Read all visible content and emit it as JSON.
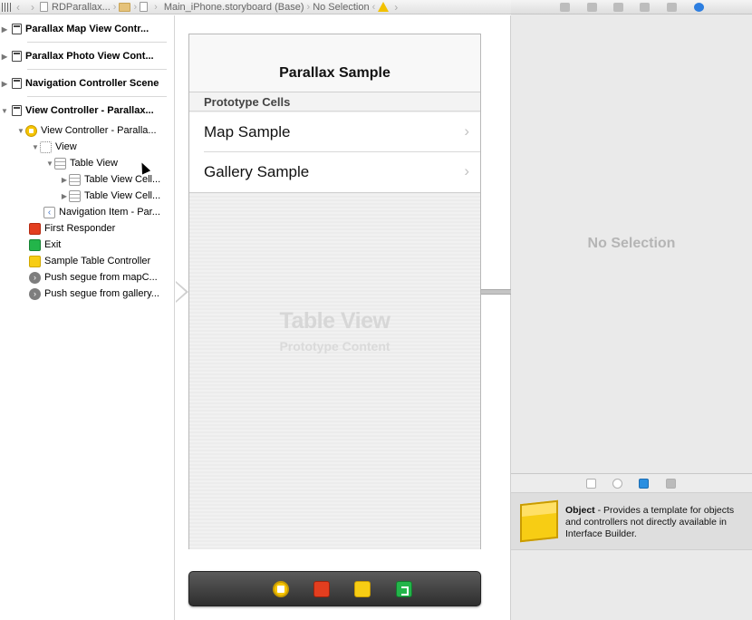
{
  "jumpbar": {
    "project": "RDParallax...",
    "file": "Main_iPhone.storyboard (Base)",
    "selection": "No Selection"
  },
  "outline": {
    "scenes": [
      {
        "label": "Parallax Map View Contr..."
      },
      {
        "label": "Parallax Photo View Cont..."
      },
      {
        "label": "Navigation Controller Scene"
      },
      {
        "label": "View Controller - Parallax..."
      }
    ],
    "tree": [
      {
        "label": "View Controller - Paralla...",
        "icon": "view-controller-icon"
      },
      {
        "label": "View",
        "icon": "view-icon"
      },
      {
        "label": "Table View",
        "icon": "table-view-icon"
      },
      {
        "label": "Table View Cell...",
        "icon": "table-view-cell-icon"
      },
      {
        "label": "Table View Cell...",
        "icon": "table-view-cell-icon"
      },
      {
        "label": "Navigation Item - Par...",
        "icon": "navigation-item-icon"
      },
      {
        "label": "First Responder",
        "icon": "first-responder-icon"
      },
      {
        "label": "Exit",
        "icon": "exit-icon"
      },
      {
        "label": "Sample Table Controller",
        "icon": "object-cube-icon"
      },
      {
        "label": "Push segue from mapC...",
        "icon": "segue-icon"
      },
      {
        "label": "Push segue from gallery...",
        "icon": "segue-icon"
      }
    ]
  },
  "scene": {
    "title": "Parallax Sample",
    "section_header": "Prototype Cells",
    "cells": [
      {
        "label": "Map Sample"
      },
      {
        "label": "Gallery Sample"
      }
    ],
    "placeholder_title": "Table View",
    "placeholder_subtitle": "Prototype Content"
  },
  "inspector": {
    "empty_label": "No Selection"
  },
  "library": {
    "item_name": "Object",
    "item_description": " - Provides a template for objects and controllers not directly available in Interface Builder."
  },
  "colors": {
    "accent": "#2d7ee0",
    "object_yellow": "#f7cd14",
    "responder_red": "#e33e1f",
    "exit_green": "#23b54a"
  }
}
